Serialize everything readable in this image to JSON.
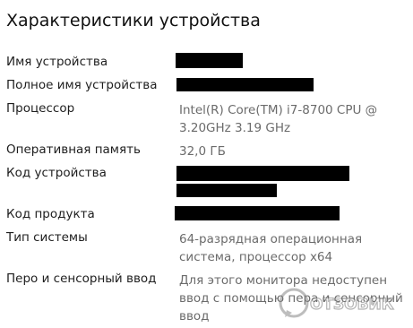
{
  "page": {
    "title": "Характеристики устройства"
  },
  "specs": [
    {
      "label": "Имя устройства",
      "value": "",
      "redacted": true
    },
    {
      "label": "Полное имя устройства",
      "value": "",
      "redacted": true
    },
    {
      "label": "Процессор",
      "value": "Intel(R) Core(TM) i7-8700 CPU @ 3.20GHz   3.19 GHz",
      "redacted": false
    },
    {
      "label": "Оперативная память",
      "value": "32,0 ГБ",
      "redacted": false
    },
    {
      "label": "Код устройства",
      "value": "",
      "redacted": true
    },
    {
      "label": "Код продукта",
      "value": "",
      "redacted": true
    },
    {
      "label": "Тип системы",
      "value": "64-разрядная операционная система, процессор x64",
      "redacted": false
    },
    {
      "label": "Перо и сенсорный ввод",
      "value": "Для этого монитора недоступен ввод с помощью пера и сенсорный ввод",
      "redacted": false
    }
  ],
  "watermark": {
    "text": "ОТЗОВИК",
    "icon": "otzovik-logo-icon"
  },
  "colors": {
    "label": "#1e1e1e",
    "value": "#6b6b6b",
    "redaction": "#000000",
    "background": "#ffffff"
  }
}
